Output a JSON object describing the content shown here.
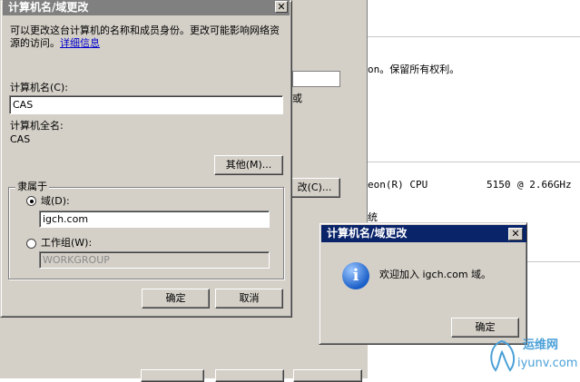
{
  "background": {
    "left_fragments": {
      "or_text": "或",
      "change_btn_label": "改(C)..."
    },
    "right_pane": {
      "copyright_text": "on。保留所有权利。",
      "cpu_label": "eon(R) CPU",
      "cpu_model": "5150",
      "cpu_speed": "@ 2.66GHz",
      "system_fragment": "统"
    }
  },
  "main_dialog": {
    "title": "计算机名/域更改",
    "close_glyph": "✕",
    "description": "可以更改这台计算机的名称和成员身份。更改可能影响网络资源的访问。",
    "details_link": "详细信息",
    "computer_name_label": "计算机名(C):",
    "computer_name_value": "CAS",
    "full_name_label": "计算机全名:",
    "full_name_value": "CAS",
    "more_button": "其他(M)...",
    "member_of_label": "隶属于",
    "domain_radio_label": "域(D):",
    "domain_value": "igch.com",
    "workgroup_radio_label": "工作组(W):",
    "workgroup_value": "WORKGROUP",
    "ok_button": "确定",
    "cancel_button": "取消"
  },
  "welcome_dialog": {
    "title": "计算机名/域更改",
    "close_glyph": "✕",
    "message": "欢迎加入 igch.com 域。",
    "info_icon_glyph": "i",
    "ok_button": "确定"
  },
  "watermark": {
    "brand": "运维网",
    "url": "iyunv.com"
  },
  "colors": {
    "window_face": "#d4d0c8",
    "active_title": "#0a246a",
    "link": "#0000cc",
    "info_icon": "#1a5fc8",
    "watermark": "#4aa0d8"
  }
}
